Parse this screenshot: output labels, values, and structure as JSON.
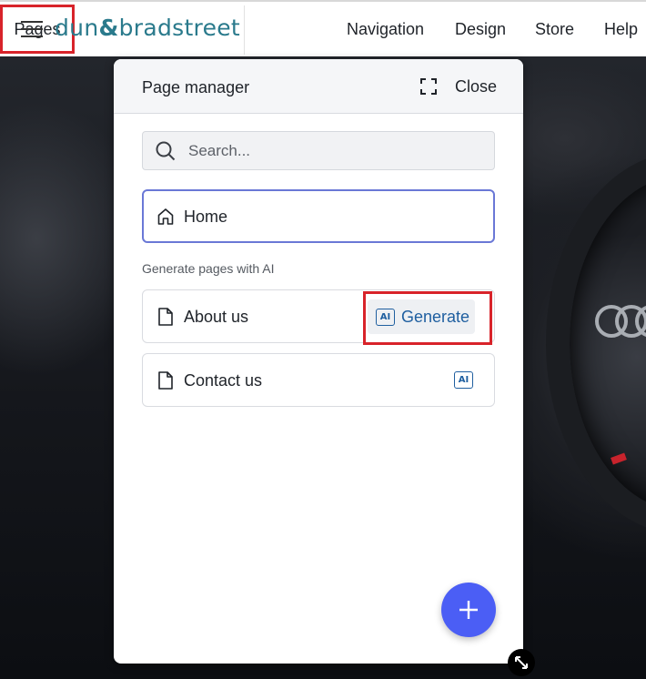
{
  "topbar": {
    "logo_text_left": "dun",
    "logo_amp": "&",
    "logo_text_right": "bradstreet",
    "nav": [
      "Pages",
      "Navigation",
      "Design",
      "Store",
      "Help"
    ]
  },
  "panel": {
    "title": "Page manager",
    "close_label": "Close",
    "search": {
      "placeholder": "Search...",
      "value": ""
    },
    "home": {
      "label": "Home"
    },
    "section_label": "Generate pages with AI",
    "ai_pages": [
      {
        "label": "About us",
        "action": "Generate",
        "badge": "AI"
      },
      {
        "label": "Contact us",
        "badge": "AI"
      }
    ]
  },
  "colors": {
    "accent": "#4b5ef5",
    "ai_blue": "#1f5fa0",
    "highlight_red": "#d8232a",
    "logo_teal": "#2a7a8c",
    "selected_border": "#6a78d6"
  },
  "icons": [
    "menu-icon",
    "expand-icon",
    "search-icon",
    "home-icon",
    "page-icon",
    "ai-icon",
    "plus-icon",
    "resize-icon"
  ]
}
